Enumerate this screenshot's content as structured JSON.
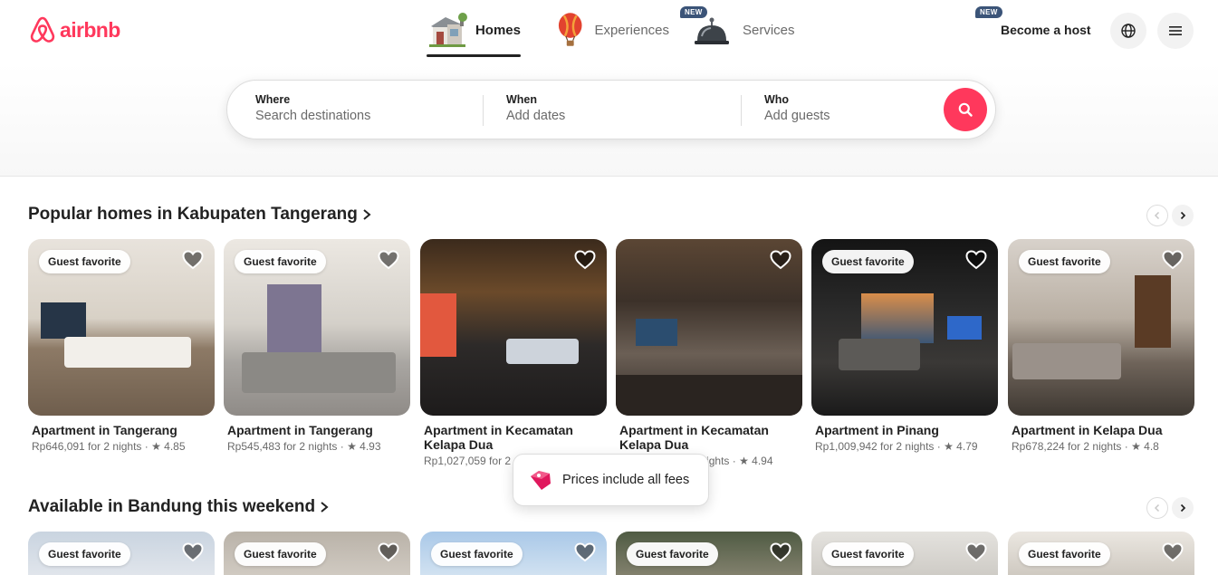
{
  "brand": {
    "name": "airbnb",
    "color": "#ff385c"
  },
  "nav": {
    "tabs": [
      {
        "label": "Homes",
        "icon": "house-icon",
        "active": true,
        "badge": ""
      },
      {
        "label": "Experiences",
        "icon": "hot-air-balloon-icon",
        "active": false,
        "badge": "NEW"
      },
      {
        "label": "Services",
        "icon": "service-bell-icon",
        "active": false,
        "badge": "NEW"
      }
    ]
  },
  "header_actions": {
    "become_host": "Become a host",
    "language_icon": "globe-icon",
    "menu_icon": "hamburger-menu-icon"
  },
  "search": {
    "where_label": "Where",
    "where_placeholder": "Search destinations",
    "when_label": "When",
    "when_placeholder": "Add dates",
    "who_label": "Who",
    "who_placeholder": "Add guests",
    "button_icon": "search-icon"
  },
  "sections": [
    {
      "title": "Popular homes in Kabupaten Tangerang",
      "listings": [
        {
          "badge": "Guest favorite",
          "title": "Apartment in Tangerang",
          "meta": "Rp646,091 for 2 nights · ★ 4.85"
        },
        {
          "badge": "Guest favorite",
          "title": "Apartment in Tangerang",
          "meta": "Rp545,483 for 2 nights · ★ 4.93"
        },
        {
          "badge": "",
          "title": "Apartment in Kecamatan Kelapa Dua",
          "meta": "Rp1,027,059 for 2 nights · ★ 4.96"
        },
        {
          "badge": "",
          "title": "Apartment in Kecamatan Kelapa Dua",
          "meta": "Rp822,588 for 2 nights · ★ 4.94"
        },
        {
          "badge": "Guest favorite",
          "title": "Apartment in Pinang",
          "meta": "Rp1,009,942 for 2 nights · ★ 4.79"
        },
        {
          "badge": "Guest favorite",
          "title": "Apartment in Kelapa Dua",
          "meta": "Rp678,224 for 2 nights · ★ 4.8"
        }
      ]
    },
    {
      "title": "Available in Bandung this weekend",
      "listings": [
        {
          "badge": "Guest favorite"
        },
        {
          "badge": "Guest favorite"
        },
        {
          "badge": "Guest favorite"
        },
        {
          "badge": "Guest favorite"
        },
        {
          "badge": "Guest favorite"
        },
        {
          "badge": "Guest favorite"
        }
      ]
    }
  ],
  "toast": {
    "text": "Prices include all fees",
    "icon": "price-tag-icon"
  }
}
